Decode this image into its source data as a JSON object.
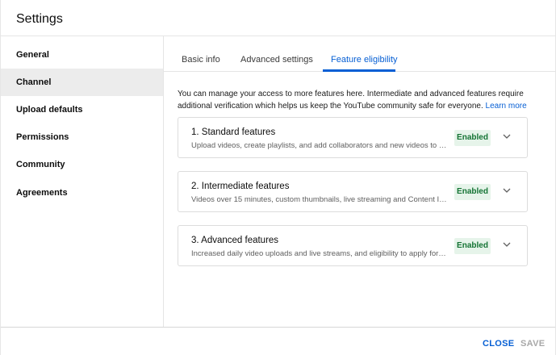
{
  "header": {
    "title": "Settings"
  },
  "sidebar": {
    "items": [
      {
        "label": "General"
      },
      {
        "label": "Channel"
      },
      {
        "label": "Upload defaults"
      },
      {
        "label": "Permissions"
      },
      {
        "label": "Community"
      },
      {
        "label": "Agreements"
      }
    ],
    "active": "Channel"
  },
  "tabs": [
    {
      "label": "Basic info"
    },
    {
      "label": "Advanced settings"
    },
    {
      "label": "Feature eligibility"
    }
  ],
  "active_tab": "Feature eligibility",
  "intro": {
    "text": "You can manage your access to more features here. Intermediate and advanced features require additional verification which helps us keep the YouTube community safe for everyone.",
    "learn_more": "Learn more"
  },
  "features": [
    {
      "title": "1. Standard features",
      "description": "Upload videos, create playlists, and add collaborators and new videos to playlists",
      "status": "Enabled"
    },
    {
      "title": "2. Intermediate features",
      "description": "Videos over 15 minutes, custom thumbnails, live streaming and Content ID appeals",
      "status": "Enabled"
    },
    {
      "title": "3. Advanced features",
      "description": "Increased daily video uploads and live streams, and eligibility to apply for monetization",
      "status": "Enabled"
    }
  ],
  "footer": {
    "close_label": "CLOSE",
    "save_label": "SAVE"
  },
  "colors": {
    "accent": "#065fd4",
    "enabled_bg": "#e6f4ea",
    "enabled_text": "#137333",
    "active_item_bg": "#ececec"
  },
  "icons": {
    "card_toggle": "chevron-down-icon"
  }
}
